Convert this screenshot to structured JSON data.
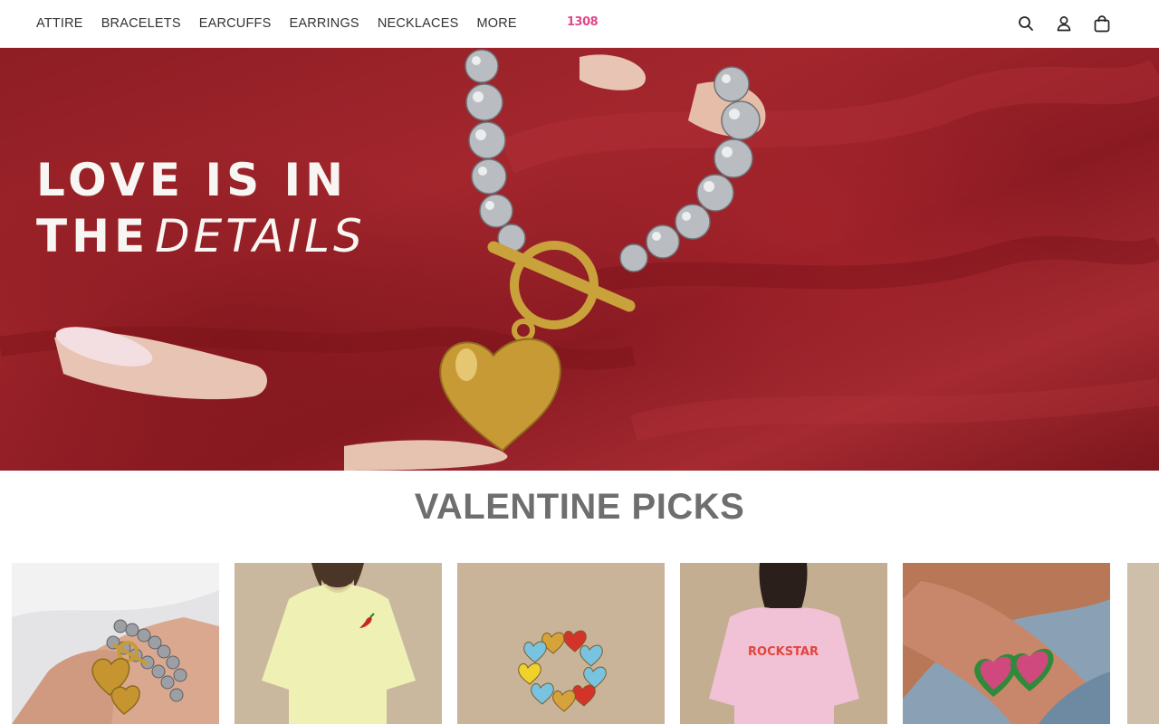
{
  "nav": {
    "items": [
      "ATTIRE",
      "BRACELETS",
      "EARCUFFS",
      "EARRINGS",
      "NECKLACES",
      "MORE"
    ],
    "logo_text": "1308"
  },
  "header_icons": [
    "search-icon",
    "account-icon",
    "bag-icon"
  ],
  "hero": {
    "line1": "LOVE IS IN",
    "line2_bold": "THE",
    "line2_italic": "DETAILS"
  },
  "section": {
    "title": "VALENTINE PICKS"
  },
  "products": [
    {
      "name": "silver-bead-bracelet-heart-charm",
      "bg": "#e9e9e9"
    },
    {
      "name": "yellow-tshirt-chili",
      "bg": "#c9b79e"
    },
    {
      "name": "enamel-heart-ring",
      "bg": "#c9b49a"
    },
    {
      "name": "pink-rockstar-tshirt",
      "bg": "#c4ae92",
      "print_text": "ROCKSTAR"
    },
    {
      "name": "pave-heart-rings",
      "bg": "#b57a5e"
    }
  ],
  "colors": {
    "hero_red": "#9b2229",
    "logo_pink": "#e0468a",
    "section_title": "#6e6e6e"
  }
}
